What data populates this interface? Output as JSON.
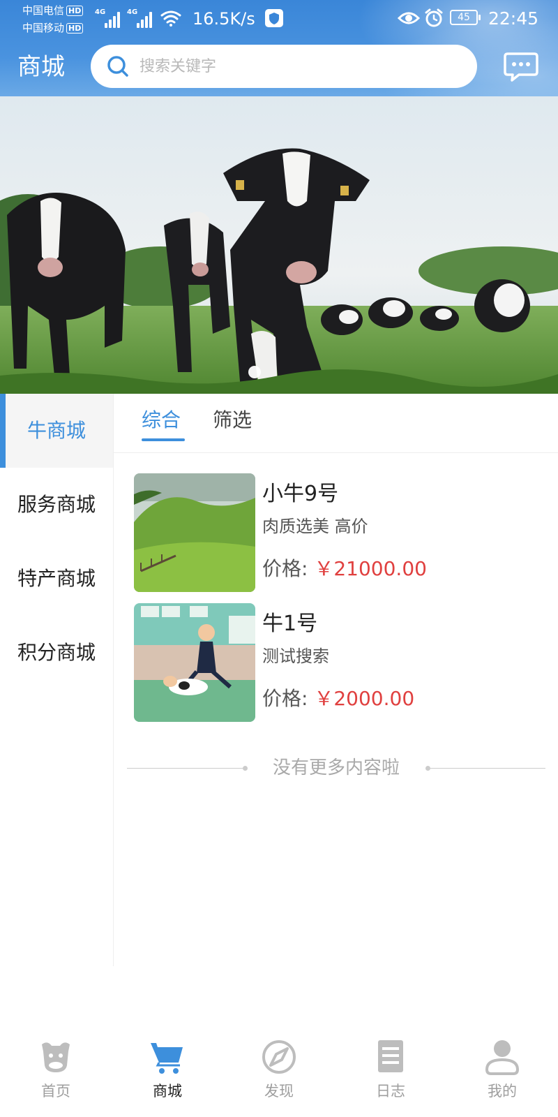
{
  "status_bar": {
    "carrier_1": "中国电信",
    "carrier_2": "中国移动",
    "hd": "HD",
    "network_1": "4G",
    "network_2": "4G",
    "net_speed": "16.5K/s",
    "battery": "45",
    "time": "22:45"
  },
  "header": {
    "title": "商城",
    "search_placeholder": "搜索关键字"
  },
  "sidebar": {
    "items": [
      {
        "label": "牛商城",
        "active": true
      },
      {
        "label": "服务商城",
        "active": false
      },
      {
        "label": "特产商城",
        "active": false
      },
      {
        "label": "积分商城",
        "active": false
      }
    ]
  },
  "tabs": [
    {
      "label": "综合",
      "active": true
    },
    {
      "label": "筛选",
      "active": false
    }
  ],
  "products": [
    {
      "name": "小牛9号",
      "description": "肉质选美 高价",
      "price_label": "价格:",
      "price": "￥21000.00"
    },
    {
      "name": "牛1号",
      "description": "测试搜索",
      "price_label": "价格:",
      "price": "￥2000.00"
    }
  ],
  "list_footer": "没有更多内容啦",
  "bottom_nav": {
    "items": [
      {
        "label": "首页",
        "icon": "cow-head-icon",
        "active": false
      },
      {
        "label": "商城",
        "icon": "cart-icon",
        "active": true
      },
      {
        "label": "发现",
        "icon": "compass-icon",
        "active": false
      },
      {
        "label": "日志",
        "icon": "log-icon",
        "active": false
      },
      {
        "label": "我的",
        "icon": "user-icon",
        "active": false
      }
    ]
  },
  "colors": {
    "accent": "#3d8fdc",
    "price": "#e0403f",
    "header": "#3a86d8"
  }
}
